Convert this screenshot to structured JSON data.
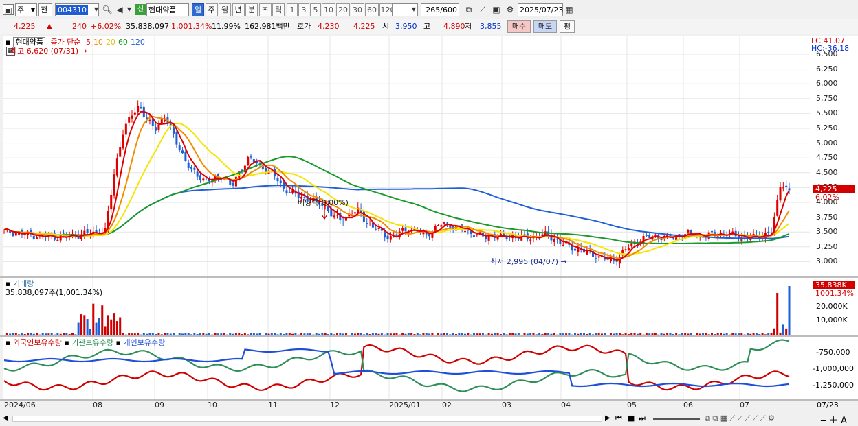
{
  "toolbar": {
    "market_label": "주",
    "period_label": "전",
    "ticker_code": "004310",
    "badge": "신",
    "stock_name": "현대약품",
    "intervals": [
      "일",
      "주",
      "월",
      "년",
      "분",
      "초",
      "틱"
    ],
    "active_interval": "일",
    "tick_counts": [
      "1",
      "3",
      "5",
      "10",
      "20",
      "30",
      "60",
      "120"
    ],
    "bar_count": "265",
    "bar_total": "/600",
    "date": "2025/07/23"
  },
  "quote": {
    "price": "4,225",
    "change_arrow": "▲",
    "change": "240",
    "change_pct": "+6.02%",
    "volume": "35,838,097",
    "volume_ratio": "1,001.34%",
    "turnover": "11.99%",
    "amount": "162,981백만",
    "hoga_label": "호가",
    "ask": "4,230",
    "bid": "4,225",
    "open_label": "시",
    "open": "3,950",
    "high_label": "고",
    "high": "4,890",
    "low_label": "저",
    "low": "3,855",
    "buy_label": "매수",
    "sell_label": "매도",
    "flat_label": "평"
  },
  "price_panel": {
    "stock": "현대약품",
    "ma_title": "종가 단순",
    "ma_periods": [
      {
        "label": "5",
        "color": "#e00000"
      },
      {
        "label": "10",
        "color": "#f08c00"
      },
      {
        "label": "20",
        "color": "#f2e600"
      },
      {
        "label": "60",
        "color": "#1a9a2a"
      },
      {
        "label": "120",
        "color": "#1f5fd8"
      }
    ],
    "high_annotation": "최고 6,620 (07/31) →",
    "low_annotation": "최저 2,995 (04/07) →",
    "dividend_annotation": "배당락(0.00%)",
    "lc": "LC:41.07",
    "hc": "HC:-36.18",
    "y_ticks": [
      "6,500",
      "6,250",
      "6,000",
      "5,750",
      "5,500",
      "5,250",
      "5,000",
      "4,750",
      "4,500",
      "4,250",
      "4,000",
      "3,750",
      "3,500",
      "3,250",
      "3,000"
    ],
    "last_price_tag": "4,225",
    "last_pct_tag": "6.02%"
  },
  "volume_panel": {
    "title": "거래량",
    "value_line": "35,838,097주(1,001.34%)",
    "last_tag": "35,838K",
    "last_pct": "1001.34%",
    "y_ticks": [
      "20,000K",
      "10,000K"
    ]
  },
  "holdings_panel": {
    "legend": [
      {
        "label": "외국인보유수량",
        "color": "#d00000"
      },
      {
        "label": "기관보유수량",
        "color": "#2f8f5a"
      },
      {
        "label": "개인보유수량",
        "color": "#1f4fd8"
      }
    ],
    "y_ticks": [
      "-750,000",
      "-1,000,000",
      "-1,250,000"
    ]
  },
  "x_axis": {
    "labels": [
      "2024/06",
      "08",
      "09",
      "10",
      "11",
      "12",
      "2025/01",
      "02",
      "03",
      "04",
      "05",
      "06",
      "07"
    ],
    "right_label": "07/23"
  },
  "chart_data": {
    "type": "candlestick",
    "title": "현대약품",
    "ylim": [
      2900,
      6700
    ],
    "close_series": [
      3560,
      3540,
      3520,
      3500,
      3480,
      3470,
      3460,
      3470,
      3480,
      3500,
      3520,
      3540,
      3560,
      4500,
      5200,
      5500,
      5700,
      5400,
      5300,
      5500,
      5200,
      4900,
      4600,
      4500,
      4400,
      4450,
      4500,
      4300,
      4600,
      4800,
      4700,
      4600,
      4500,
      4300,
      4200,
      4150,
      4100,
      4050,
      4000,
      3800,
      3750,
      3850,
      3900,
      3700,
      3600,
      3500,
      3450,
      3550,
      3600,
      3550,
      3500,
      3600,
      3700,
      3650,
      3600,
      3550,
      3500,
      3450,
      3500,
      3450,
      3480,
      3460,
      3450,
      3470,
      3500,
      3450,
      3350,
      3300,
      3250,
      3200,
      3150,
      3100,
      3050,
      3150,
      3300,
      3400,
      3450,
      3480,
      3460,
      3450,
      3500,
      3520,
      3500,
      3480,
      3500,
      3520,
      3500,
      3480,
      3450,
      3460,
      3500,
      3550,
      4400,
      4225
    ],
    "dividend_ex": "배당락(0.00%)",
    "high": {
      "value": 6620,
      "date": "07/31"
    },
    "low": {
      "value": 2995,
      "date": "04/07"
    }
  }
}
